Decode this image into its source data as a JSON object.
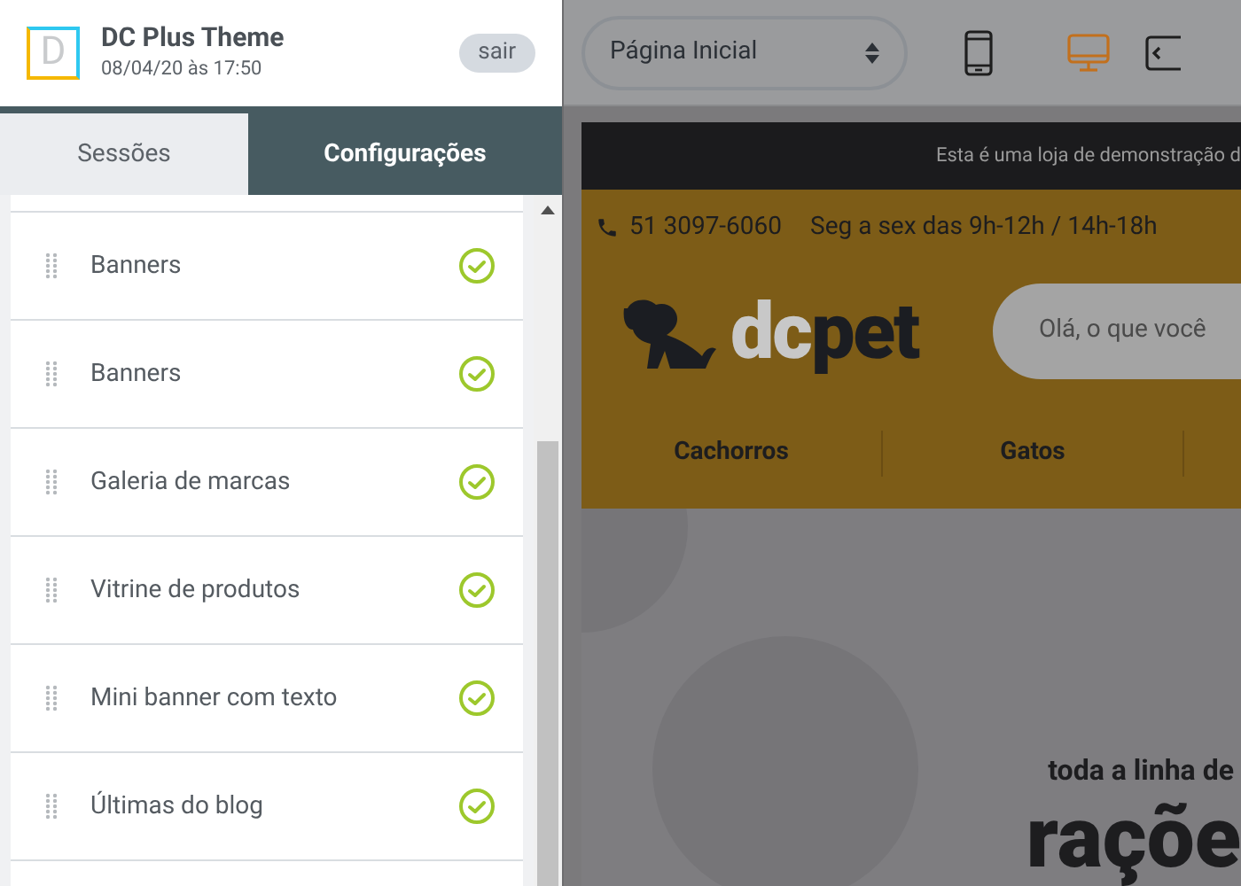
{
  "app": {
    "logo_letter": "D",
    "title": "DC Plus Theme",
    "subtitle": "08/04/20 às 17:50",
    "logout": "sair"
  },
  "tabs": [
    {
      "label": "Sessões",
      "selected": false
    },
    {
      "label": "Configurações",
      "selected": true
    }
  ],
  "sections": [
    {
      "label": "Banners",
      "checked": true
    },
    {
      "label": "Banners",
      "checked": true
    },
    {
      "label": "Galeria de marcas",
      "checked": true
    },
    {
      "label": "Vitrine de produtos",
      "checked": true
    },
    {
      "label": "Mini banner com texto",
      "checked": true
    },
    {
      "label": "Últimas do blog",
      "checked": true
    }
  ],
  "toolbar": {
    "page_select": "Página Inicial",
    "devices": [
      {
        "kind": "mobile",
        "selected": false
      },
      {
        "kind": "desktop",
        "selected": true
      },
      {
        "kind": "code",
        "selected": false
      }
    ]
  },
  "preview": {
    "notice": "Esta é uma loja de demonstração d",
    "phone": "51 3097-6060",
    "hours": "Seg a sex das 9h-12h / 14h-18h",
    "logo_light": "dc",
    "logo_dark": "pet",
    "search_placeholder": "Olá, o que você",
    "menu": [
      "Cachorros",
      "Gatos"
    ],
    "banner_small": "toda a linha de",
    "banner_big": "raçõe"
  }
}
